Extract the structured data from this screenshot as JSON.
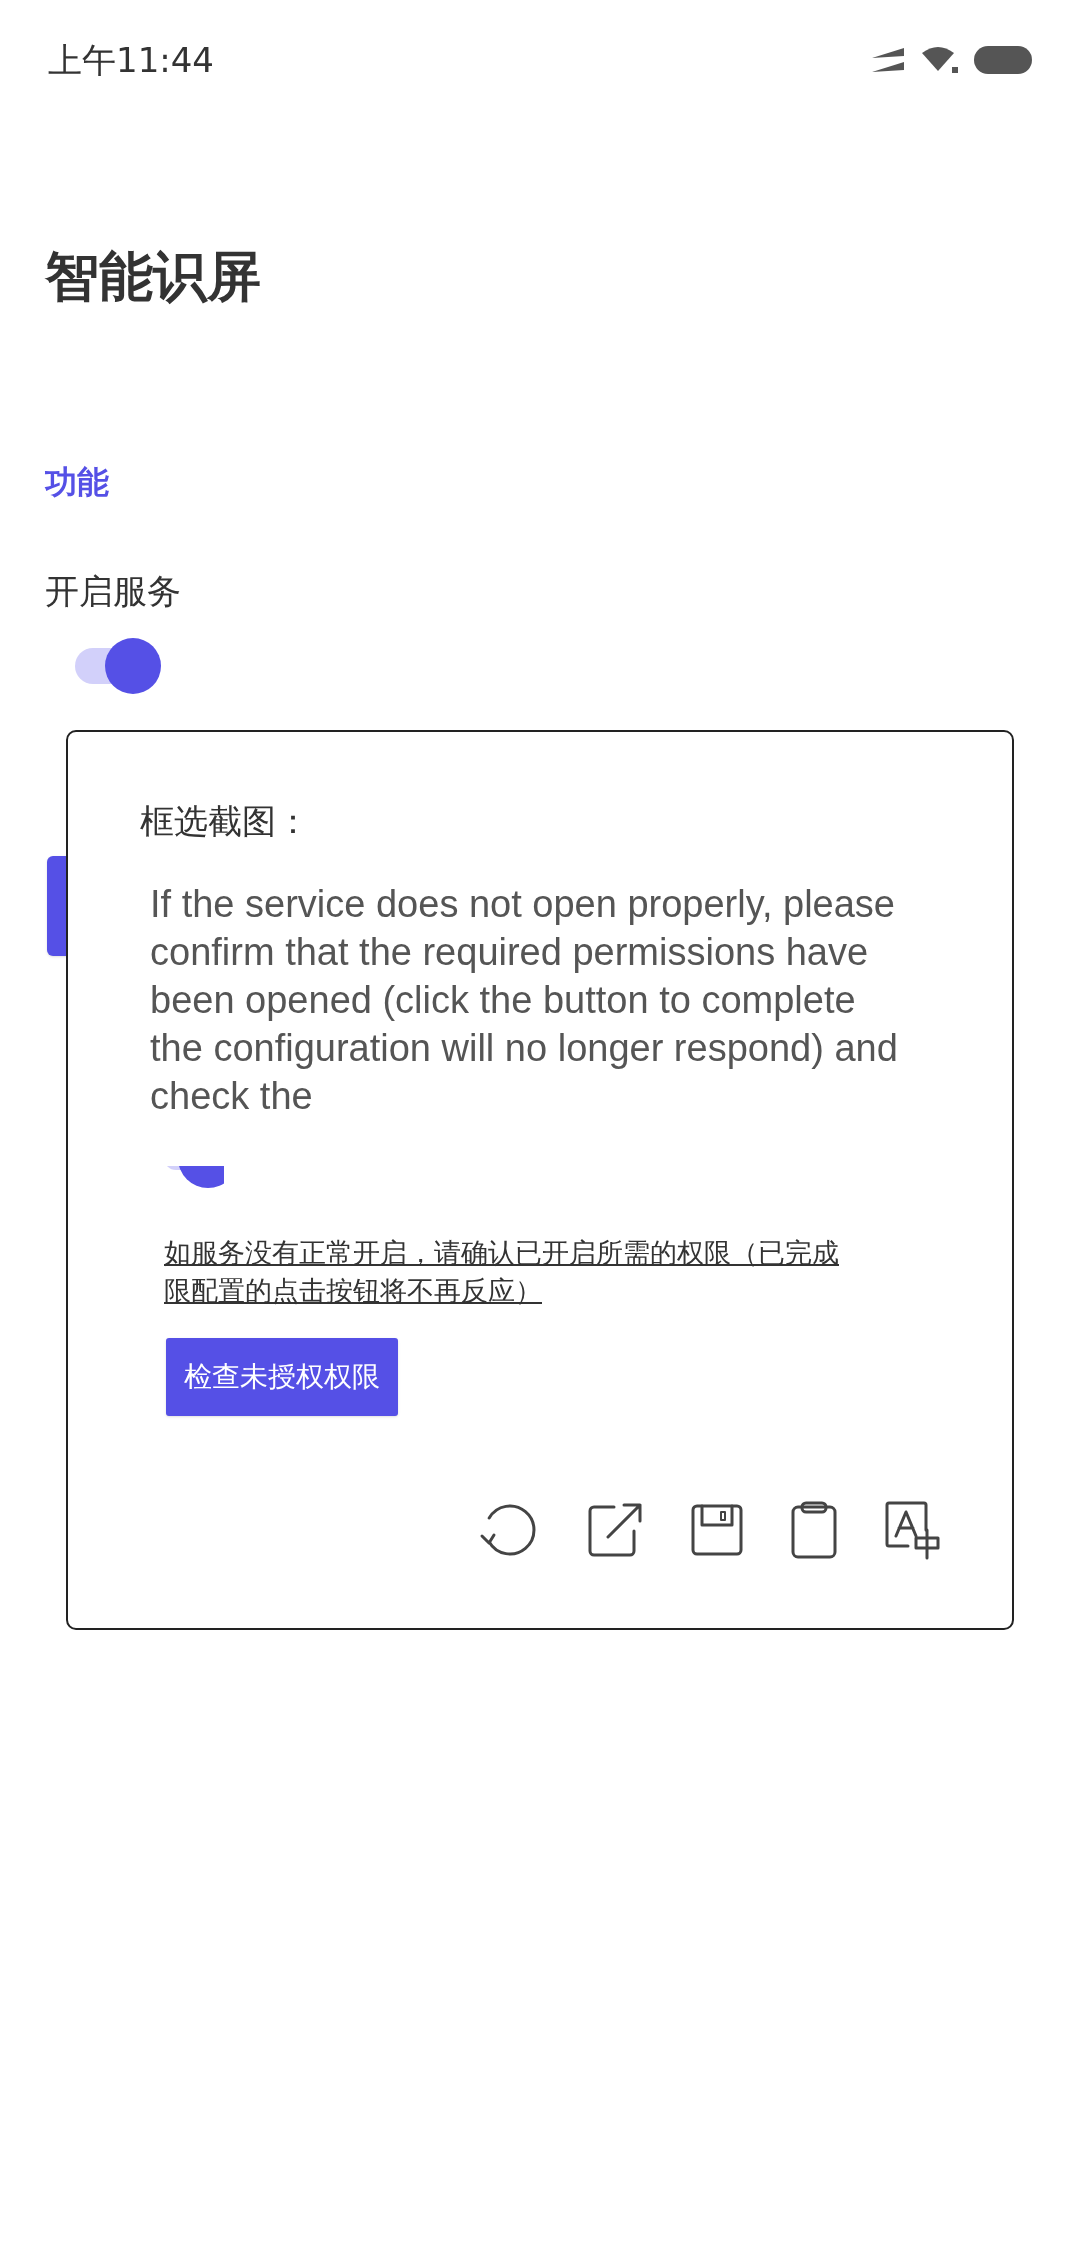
{
  "status_bar": {
    "time": "上午11:44"
  },
  "page": {
    "title": "智能识屏",
    "section_header": "功能",
    "service": {
      "label": "开启服务",
      "on": true
    }
  },
  "dialog": {
    "title": "框选截图：",
    "ocr_text": "If the service does not open properly, please confirm that the required permissions have been opened (click the button to complete the configuration will no longer respond) and check the",
    "capture": {
      "toggle_on": true,
      "notice_lines": [
        "如服务没有正常开启，请确认已开启所需的权限（已完成",
        "限配置的点击按钮将不再反应）"
      ],
      "button": "检查未授权权限"
    },
    "toolbar": [
      {
        "kind": "refresh"
      },
      {
        "kind": "open"
      },
      {
        "kind": "save"
      },
      {
        "kind": "copy"
      },
      {
        "kind": "translate"
      }
    ]
  }
}
